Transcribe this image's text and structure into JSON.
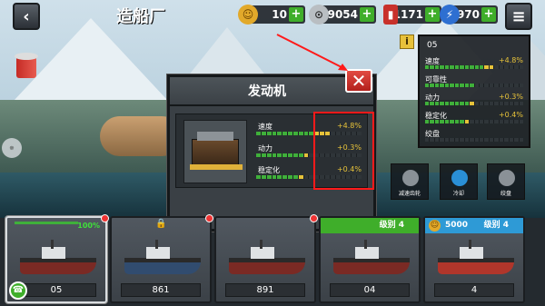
{
  "title": "造船厂",
  "resources": {
    "coins": "10",
    "silver": "9054",
    "fuel": "1171",
    "energy": "970"
  },
  "info_panel": {
    "id": "05",
    "stats": [
      {
        "label": "速度",
        "pct": "+4.8%"
      },
      {
        "label": "可靠性",
        "pct": ""
      },
      {
        "label": "动力",
        "pct": "+0.3%"
      },
      {
        "label": "稳定化",
        "pct": "+0.4%"
      },
      {
        "label": "绞盘",
        "pct": ""
      }
    ]
  },
  "modal": {
    "title": "发动机",
    "stats": [
      {
        "label": "速度",
        "pct": "+4.8%"
      },
      {
        "label": "动力",
        "pct": "+0.3%"
      },
      {
        "label": "稳定化",
        "pct": "+0.4%"
      }
    ]
  },
  "ship_parts": [
    {
      "label": "减速齿轮"
    },
    {
      "label": "冷却"
    },
    {
      "label": "绞盘"
    }
  ],
  "cards": [
    {
      "name": "05",
      "header": "100%",
      "locked": false
    },
    {
      "name": "861",
      "header": "",
      "locked": true
    },
    {
      "name": "891",
      "header": "",
      "locked": false
    },
    {
      "name": "04",
      "header": "级别 4",
      "locked": false
    },
    {
      "name": "4",
      "header_price": "5000",
      "header": "级别 4",
      "locked": false
    }
  ],
  "colors": {
    "accent_green": "#3fb03a",
    "highlight_yellow": "#e6c23a",
    "close_red": "#d0302a",
    "annotation_red": "#ff1a1a"
  }
}
